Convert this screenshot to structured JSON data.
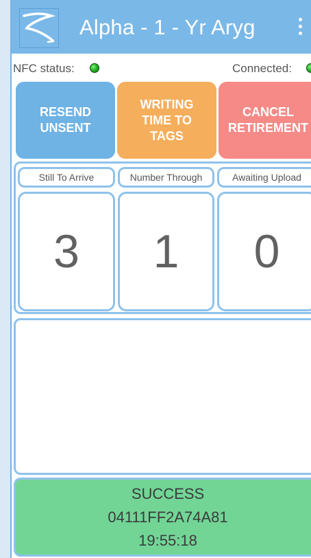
{
  "appbar": {
    "title": "Alpha - 1 - Yr Aryg",
    "logo_icon": "swoosh-logo-icon",
    "menu_icon": "more-vert-icon",
    "background": "#7ab8e8"
  },
  "status": {
    "nfc_label": "NFC status:",
    "nfc_led_color": "#2ab52a",
    "connected_label": "Connected:",
    "connected_led_color": "#2ab52a"
  },
  "actions": {
    "resend": {
      "label": "RESEND\nUNSENT",
      "color": "#6fb2e4"
    },
    "writing": {
      "label": "WRITING\nTIME TO\nTAGS",
      "color": "#f5ae5c"
    },
    "cancel": {
      "label": "CANCEL\nRETIREMENT",
      "color": "#f58a87"
    }
  },
  "stats": [
    {
      "label": "Still To Arrive",
      "value": "3"
    },
    {
      "label": "Number Through",
      "value": "1"
    },
    {
      "label": "Awaiting Upload",
      "value": "0"
    }
  ],
  "result": {
    "status": "SUCCESS",
    "tag_id": "04111FF2A74A81",
    "time": "19:55:18",
    "color": "#72d596"
  }
}
